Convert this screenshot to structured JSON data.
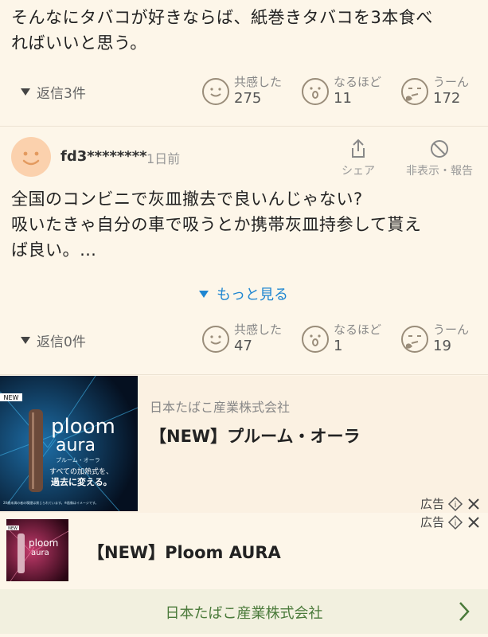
{
  "comment1": {
    "text_line1": "そんなにタバコが好きならば、紙巻きタバコを3本食べ",
    "text_line2": "ればいいと思う。",
    "reply_label": "返信3件",
    "reactions": [
      {
        "label": "共感した",
        "count": "275"
      },
      {
        "label": "なるほど",
        "count": "11"
      },
      {
        "label": "うーん",
        "count": "172"
      }
    ]
  },
  "comment2": {
    "username": "fd3********",
    "time": "1日前",
    "share_label": "シェア",
    "hide_label": "非表示・報告",
    "text_line1": "全国のコンビニで灰皿撤去で良いんじゃない?",
    "text_line2": "吸いたきゃ自分の車で吸うとか携帯灰皿持参して貰え",
    "text_line3": "ば良い。…",
    "more_label": "もっと見る",
    "reply_label": "返信0件",
    "reactions": [
      {
        "label": "共感した",
        "count": "47"
      },
      {
        "label": "なるほど",
        "count": "1"
      },
      {
        "label": "うーん",
        "count": "19"
      }
    ]
  },
  "ad1": {
    "advertiser": "日本たばこ産業株式会社",
    "title": "【NEW】プルーム・オーラ",
    "ad_label": "広告",
    "img_badge": "NEW",
    "img_brand1": "ploom",
    "img_brand2": "aura",
    "img_sub": "プルーム・オーラ",
    "img_copy1": "すべての加熱式を、",
    "img_copy2": "過去に変える。",
    "img_note": "20歳未満の者の喫煙は禁じられています。※画像はイメージです。"
  },
  "ad2": {
    "ad_label": "広告",
    "title": "【NEW】Ploom AURA",
    "advertiser": "日本たばこ産業株式会社",
    "img_badge": "NEW",
    "img_brand1": "ploom",
    "img_brand2": "aura"
  },
  "colors": {
    "background": "#fdf6e9",
    "link": "#1f86d1",
    "footer_bg": "#f2f0df",
    "footer_text": "#4a7a3a"
  }
}
